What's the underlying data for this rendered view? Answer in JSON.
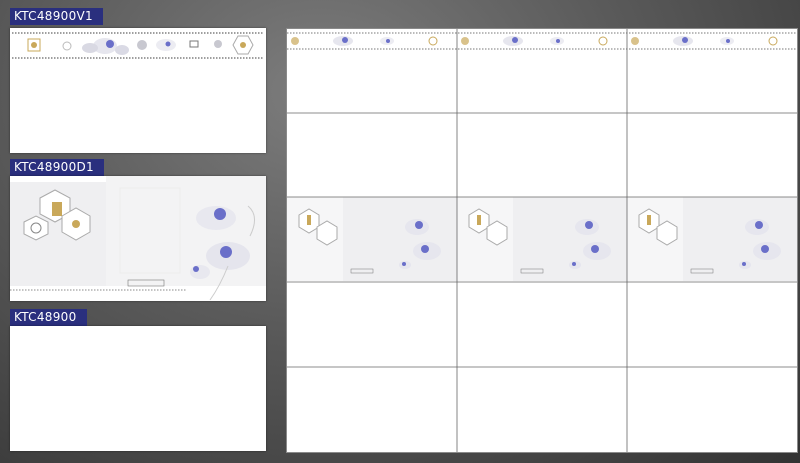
{
  "products": [
    {
      "code": "KTC48900V1",
      "type": "border"
    },
    {
      "code": "KTC48900D1",
      "type": "decor"
    },
    {
      "code": "KTC48900",
      "type": "plain"
    }
  ],
  "wall": {
    "columns": 3,
    "rows": [
      {
        "tile": "KTC48900V1"
      },
      {
        "tile": "KTC48900"
      },
      {
        "tile": "KTC48900D1"
      },
      {
        "tile": "KTC48900"
      },
      {
        "tile": "KTC48900"
      }
    ]
  },
  "colors": {
    "label_bg": "#2a2f7e",
    "flower": "#6a6fc9",
    "gold": "#c9a85a"
  }
}
